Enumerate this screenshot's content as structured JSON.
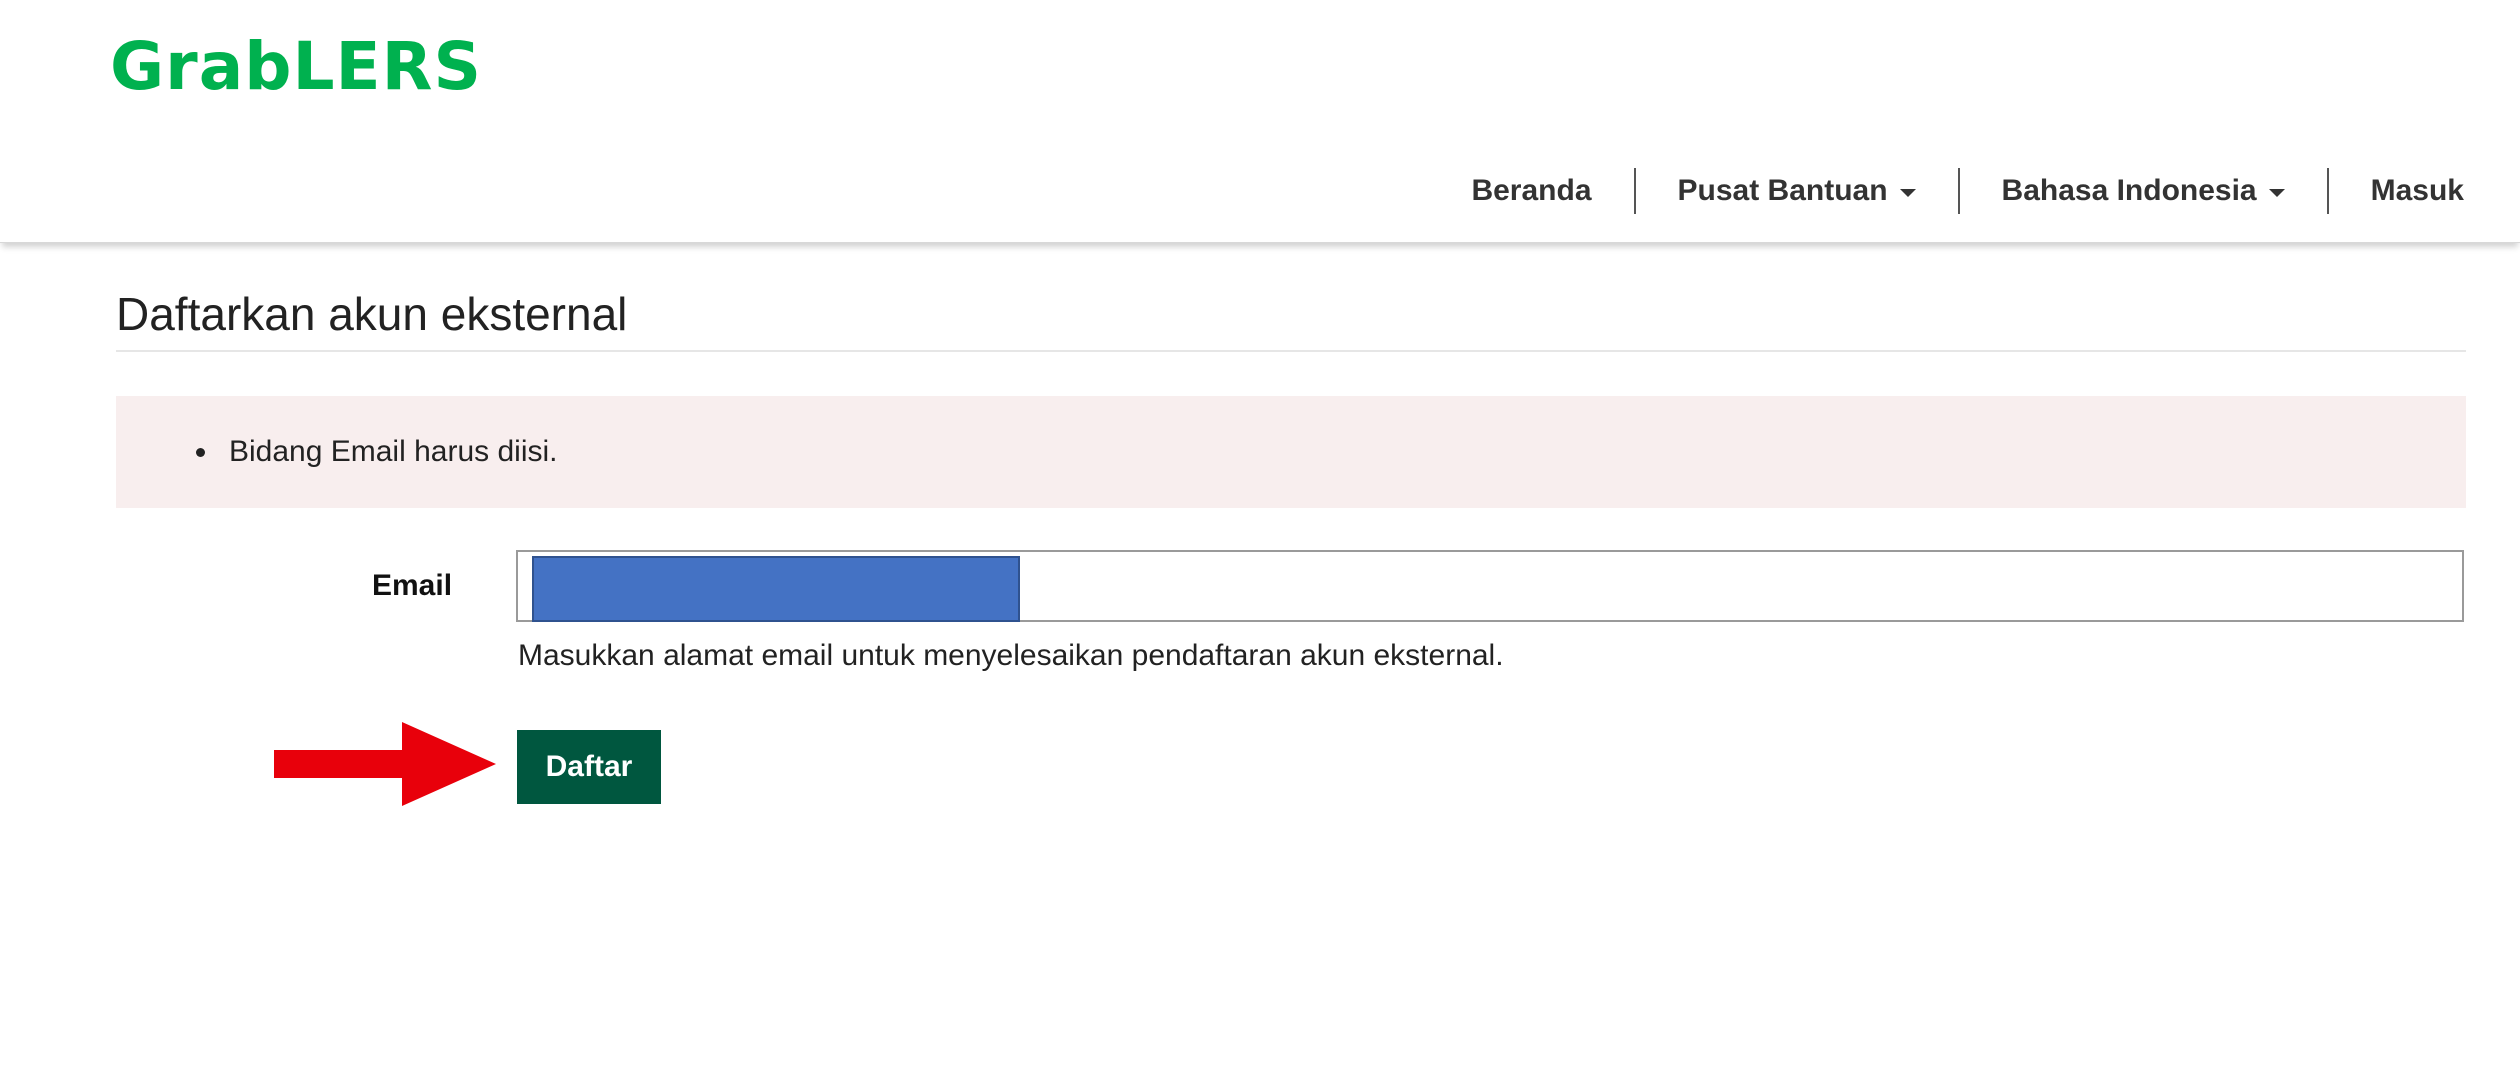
{
  "header": {
    "logo_text": "GrabLERS",
    "brand_color": "#00b14f",
    "nav": [
      {
        "label": "Beranda",
        "has_dropdown": false
      },
      {
        "label": "Pusat Bantuan",
        "has_dropdown": true
      },
      {
        "label": "Bahasa Indonesia",
        "has_dropdown": true
      },
      {
        "label": "Masuk",
        "has_dropdown": false
      }
    ]
  },
  "main": {
    "title": "Daftarkan akun eksternal",
    "errors": [
      "Bidang Email harus diisi."
    ],
    "error_bg_color": "#f8eeee",
    "email": {
      "label": "Email",
      "value": "",
      "redacted": true,
      "help_text": "Masukkan alamat email untuk menyelesaikan pendaftaran akun eksternal."
    },
    "submit_label": "Daftar",
    "submit_color": "#00573f"
  },
  "annotation": {
    "icon": "arrow-right-icon",
    "color": "#e8000b"
  }
}
